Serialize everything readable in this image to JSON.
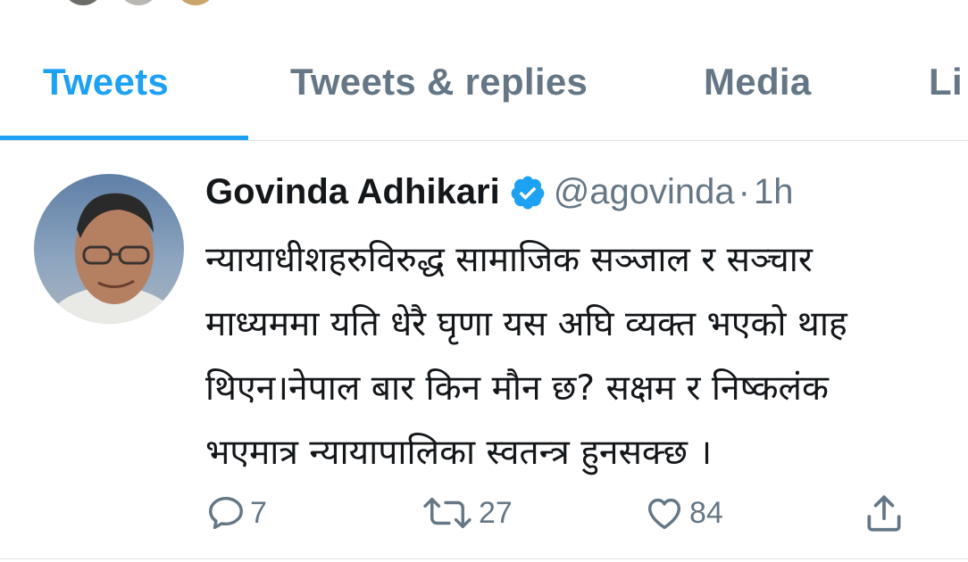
{
  "tabs": {
    "items": [
      {
        "label": "Tweets",
        "active": true
      },
      {
        "label": "Tweets & replies",
        "active": false
      },
      {
        "label": "Media",
        "active": false
      },
      {
        "label": "Li",
        "active": false
      }
    ],
    "accent_color": "#1da1f2",
    "inactive_color": "#657786"
  },
  "tweet": {
    "display_name": "Govinda Adhikari",
    "verified_icon": "verified-badge-icon",
    "handle": "@agovinda",
    "separator": "·",
    "time": "1h",
    "text_lines": [
      "न्यायाधीशहरुविरुद्ध सामाजिक सञ्जाल र सञ्चार",
      "माध्यममा यति धेरै घृणा यस अघि व्यक्त भएको थाह",
      "थिएन।नेपाल बार किन मौन छ?  सक्षम र निष्कलंक",
      "भएमात्र न्यायापालिका स्वतन्त्र हुनसक्छ ।"
    ],
    "actions": {
      "reply": {
        "icon": "reply-icon",
        "count": "7"
      },
      "retweet": {
        "icon": "retweet-icon",
        "count": "27"
      },
      "like": {
        "icon": "heart-icon",
        "count": "84"
      },
      "share": {
        "icon": "share-icon"
      }
    }
  }
}
